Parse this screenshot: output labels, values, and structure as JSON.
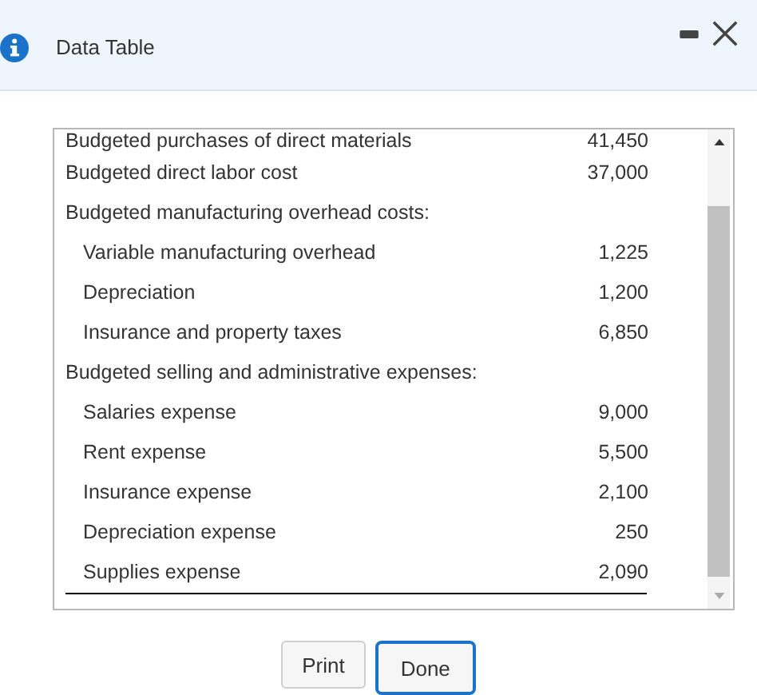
{
  "window": {
    "title": "Data Table"
  },
  "table": {
    "rows": [
      {
        "label": "Budgeted purchases of direct materials",
        "amount": "41,450"
      },
      {
        "label": "Budgeted direct labor cost",
        "amount": "37,000"
      },
      {
        "label": "Budgeted manufacturing overhead costs:",
        "children": [
          {
            "label": "Variable manufacturing overhead",
            "amount": "1,225"
          },
          {
            "label": "Depreciation",
            "amount": "1,200"
          },
          {
            "label": "Insurance and property taxes",
            "amount": "6,850"
          }
        ]
      },
      {
        "label": "Budgeted selling and administrative expenses:",
        "children": [
          {
            "label": "Salaries expense",
            "amount": "9,000"
          },
          {
            "label": "Rent expense",
            "amount": "5,500"
          },
          {
            "label": "Insurance expense",
            "amount": "2,100"
          },
          {
            "label": "Depreciation expense",
            "amount": "250"
          },
          {
            "label": "Supplies expense",
            "amount": "2,090"
          }
        ]
      }
    ]
  },
  "buttons": [
    {
      "label": "Print",
      "focused": false
    },
    {
      "label": "Done",
      "focused": true
    }
  ]
}
